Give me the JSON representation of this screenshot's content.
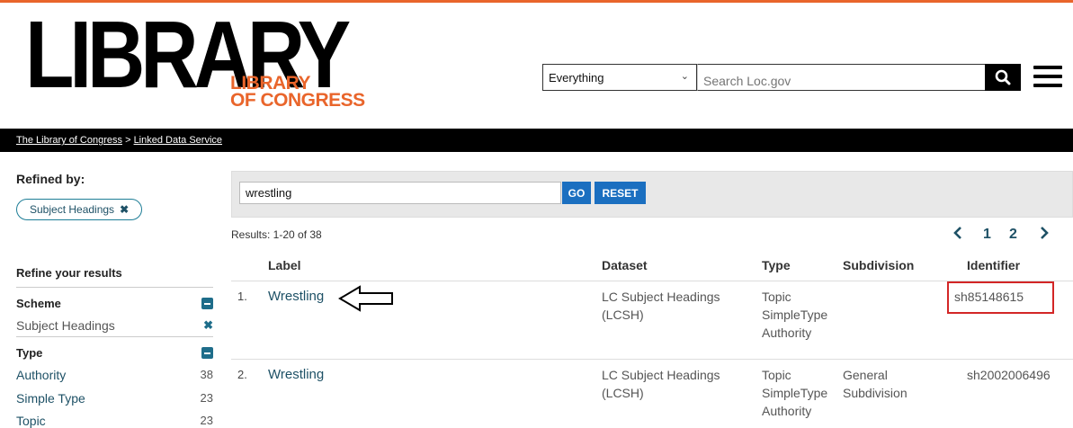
{
  "header": {
    "logo_big": "LIBRARY",
    "logo_line1": "LIBRARY",
    "logo_line2": "OF CONGRESS",
    "scope_value": "Everything",
    "search_placeholder": "Search Loc.gov"
  },
  "breadcrumb": {
    "home": "The Library of Congress",
    "separator": ">",
    "current": "Linked Data Service"
  },
  "sidebar": {
    "refined_by": "Refined by:",
    "active_chip": "Subject Headings",
    "refine_title": "Refine your results",
    "facets": [
      {
        "title": "Scheme",
        "items": [
          {
            "label": "Subject Headings",
            "count": ""
          }
        ]
      },
      {
        "title": "Type",
        "items": [
          {
            "label": "Authority",
            "count": "38"
          },
          {
            "label": "Simple Type",
            "count": "23"
          },
          {
            "label": "Topic",
            "count": "23"
          }
        ]
      }
    ]
  },
  "search": {
    "term": "wrestling",
    "go_label": "GO",
    "reset_label": "RESET",
    "results_text": "Results: 1-20 of 38"
  },
  "pager": {
    "pages": [
      "1",
      "2"
    ]
  },
  "table": {
    "headers": {
      "label": "Label",
      "dataset": "Dataset",
      "type": "Type",
      "subdivision": "Subdivision",
      "identifier": "Identifier"
    },
    "rows": [
      {
        "num": "1.",
        "label": "Wrestling",
        "dataset": [
          "LC Subject Headings",
          "(LCSH)"
        ],
        "type": [
          "Topic",
          "SimpleType",
          "Authority"
        ],
        "subdivision": [
          "",
          ""
        ],
        "identifier": "sh85148615"
      },
      {
        "num": "2.",
        "label": "Wrestling",
        "dataset": [
          "LC Subject Headings",
          "(LCSH)"
        ],
        "type": [
          "Topic",
          "SimpleType",
          "Authority"
        ],
        "subdivision": [
          "General",
          "Subdivision"
        ],
        "identifier": "sh2002006496"
      }
    ]
  },
  "colors": {
    "accent_orange": "#e9652b",
    "link_blue": "#1e5166",
    "button_blue": "#1b6fc0",
    "highlight_red": "#d32626"
  }
}
